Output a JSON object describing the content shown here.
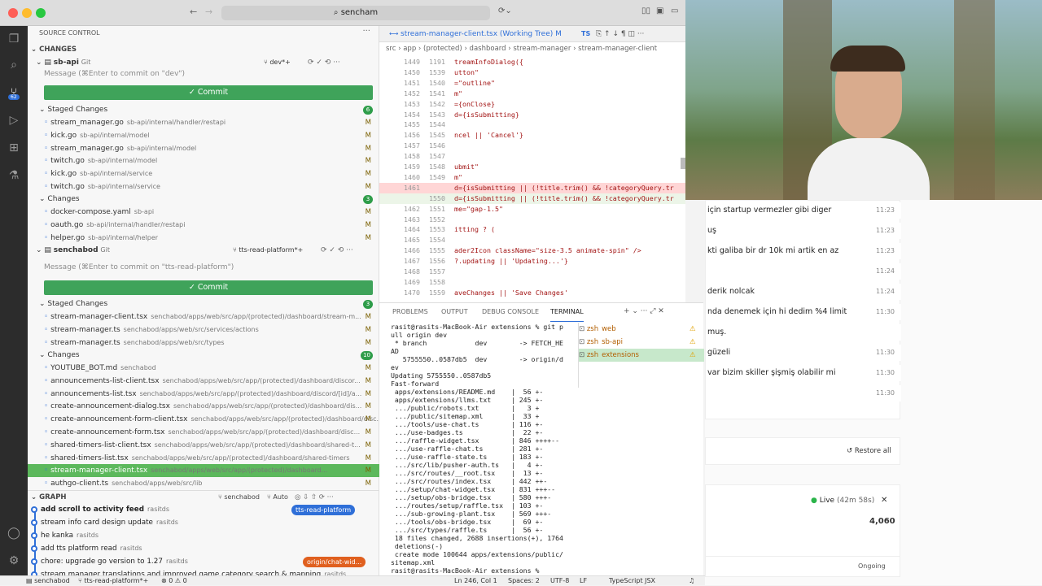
{
  "window": {
    "search": "sencham"
  },
  "sidebar": {
    "title": "SOURCE CONTROL",
    "changes_header": "CHANGES",
    "repo1": {
      "name": "sb-api",
      "vcs": "Git",
      "branch": "dev*+",
      "msg": "Message (⌘Enter to commit on \"dev\")",
      "commit": "Commit",
      "staged_label": "Staged Changes",
      "staged_count": "6",
      "staged": [
        {
          "file": "stream_manager.go",
          "path": "sb-api/internal/handler/restapi",
          "s": "M"
        },
        {
          "file": "kick.go",
          "path": "sb-api/internal/model",
          "s": "M"
        },
        {
          "file": "stream_manager.go",
          "path": "sb-api/internal/model",
          "s": "M"
        },
        {
          "file": "twitch.go",
          "path": "sb-api/internal/model",
          "s": "M"
        },
        {
          "file": "kick.go",
          "path": "sb-api/internal/service",
          "s": "M"
        },
        {
          "file": "twitch.go",
          "path": "sb-api/internal/service",
          "s": "M"
        }
      ],
      "changes_label": "Changes",
      "changes_count": "3",
      "changes": [
        {
          "file": "docker-compose.yaml",
          "path": "sb-api",
          "s": "M"
        },
        {
          "file": "oauth.go",
          "path": "sb-api/internal/handler/restapi",
          "s": "M"
        },
        {
          "file": "helper.go",
          "path": "sb-api/internal/helper",
          "s": "M"
        }
      ]
    },
    "repo2": {
      "name": "senchabod",
      "vcs": "Git",
      "branch": "tts-read-platform*+",
      "msg": "Message (⌘Enter to commit on \"tts-read-platform\")",
      "commit": "Commit",
      "staged_label": "Staged Changes",
      "staged_count": "3",
      "staged": [
        {
          "file": "stream-manager-client.tsx",
          "path": "senchabod/apps/web/src/app/(protected)/dashboard/stream-m...",
          "s": "M"
        },
        {
          "file": "stream-manager.ts",
          "path": "senchabod/apps/web/src/services/actions",
          "s": "M"
        },
        {
          "file": "stream-manager.ts",
          "path": "senchabod/apps/web/src/types",
          "s": "M"
        }
      ],
      "changes_label": "Changes",
      "changes_count": "10",
      "changes": [
        {
          "file": "YOUTUBE_BOT.md",
          "path": "senchabod",
          "s": "M"
        },
        {
          "file": "announcements-list-client.tsx",
          "path": "senchabod/apps/web/src/app/(protected)/dashboard/discor...",
          "s": "M"
        },
        {
          "file": "announcements-list.tsx",
          "path": "senchabod/apps/web/src/app/(protected)/dashboard/discord/[id]/a...",
          "s": "M"
        },
        {
          "file": "create-announcement-dialog.tsx",
          "path": "senchabod/apps/web/src/app/(protected)/dashboard/dis...",
          "s": "M"
        },
        {
          "file": "create-announcement-form-client.tsx",
          "path": "senchabod/apps/web/src/app/(protected)/dashboard/disc...",
          "s": "M"
        },
        {
          "file": "create-announcement-form.tsx",
          "path": "senchabod/apps/web/src/app/(protected)/dashboard/disc...",
          "s": "M"
        },
        {
          "file": "shared-timers-list-client.tsx",
          "path": "senchabod/apps/web/src/app/(protected)/dashboard/shared-t...",
          "s": "M"
        },
        {
          "file": "shared-timers-list.tsx",
          "path": "senchabod/apps/web/src/app/(protected)/dashboard/shared-timers",
          "s": "M"
        },
        {
          "file": "stream-manager-client.tsx",
          "path": "senchabod/apps/web/src/app/(protected)/dashboard...",
          "s": "M"
        },
        {
          "file": "authgo-client.ts",
          "path": "senchabod/apps/web/src/lib",
          "s": "M"
        }
      ]
    },
    "graph": {
      "label": "GRAPH",
      "branch": "senchabod",
      "auto": "Auto",
      "commits": [
        {
          "msg": "add scroll to activity feed",
          "author": "rasitds",
          "tag": "tts-read-platform"
        },
        {
          "msg": "stream info card design update",
          "author": "rasitds"
        },
        {
          "msg": "he kanka",
          "author": "rasitds"
        },
        {
          "msg": "add tts platform read",
          "author": "rasitds"
        },
        {
          "msg": "chore: upgrade go version to 1.27",
          "author": "rasitds",
          "tag": "origin/chat-wid..."
        },
        {
          "msg": "stream manager translations and improved game category search & mapping",
          "author": "rasitds"
        }
      ]
    }
  },
  "editor": {
    "tab": "stream-manager-client.tsx (Working Tree)",
    "tab_flag": "M",
    "tab2": "TS",
    "crumbs": "src › app › (protected) › dashboard › stream-manager › stream-manager-client",
    "lines": [
      {
        "a": "1449",
        "b": "1191",
        "c": "treamInfoDialog({",
        "k": ""
      },
      {
        "a": "1450",
        "b": "1539",
        "c": "utton\"",
        "k": ""
      },
      {
        "a": "1451",
        "b": "1540",
        "c": "=\"outline\"",
        "k": ""
      },
      {
        "a": "1452",
        "b": "1541",
        "c": "m\"",
        "k": ""
      },
      {
        "a": "1453",
        "b": "1542",
        "c": "={onClose}",
        "k": ""
      },
      {
        "a": "1454",
        "b": "1543",
        "c": "d={isSubmitting}",
        "k": ""
      },
      {
        "a": "1455",
        "b": "1544",
        "c": "",
        "k": ""
      },
      {
        "a": "1456",
        "b": "1545",
        "c": "ncel || 'Cancel'}",
        "k": ""
      },
      {
        "a": "1457",
        "b": "1546",
        "c": "",
        "k": ""
      },
      {
        "a": "1458",
        "b": "1547",
        "c": "",
        "k": ""
      },
      {
        "a": "1459",
        "b": "1548",
        "c": "ubmit\"",
        "k": ""
      },
      {
        "a": "1460",
        "b": "1549",
        "c": "m\"",
        "k": ""
      },
      {
        "a": "1461",
        "b": "",
        "c": "d={isSubmitting || (!title.trim() && !categoryQuery.tr",
        "k": "del"
      },
      {
        "a": "",
        "b": "1550",
        "c": "d={isSubmitting || (!title.trim() && !categoryQuery.tr",
        "k": "add"
      },
      {
        "a": "1462",
        "b": "1551",
        "c": "me=\"gap-1.5\"",
        "k": ""
      },
      {
        "a": "1463",
        "b": "1552",
        "c": "",
        "k": ""
      },
      {
        "a": "1464",
        "b": "1553",
        "c": "itting ? (",
        "k": ""
      },
      {
        "a": "1465",
        "b": "1554",
        "c": "",
        "k": ""
      },
      {
        "a": "1466",
        "b": "1555",
        "c": "ader2Icon className=\"size-3.5 animate-spin\" />",
        "k": ""
      },
      {
        "a": "1467",
        "b": "1556",
        "c": "?.updating || 'Updating...'}",
        "k": ""
      },
      {
        "a": "1468",
        "b": "1557",
        "c": "",
        "k": ""
      },
      {
        "a": "1469",
        "b": "1558",
        "c": "",
        "k": ""
      },
      {
        "a": "1470",
        "b": "1559",
        "c": "aveChanges || 'Save Changes'",
        "k": ""
      }
    ]
  },
  "panel": {
    "tabs": [
      "PROBLEMS",
      "OUTPUT",
      "DEBUG CONSOLE",
      "TERMINAL"
    ],
    "active": "TERMINAL",
    "terminal": "rasit@rasits-MacBook-Air extensions % git p\null origin dev\n * branch            dev        -> FETCH_HE\nAD\n   5755550..0587db5  dev        -> origin/d\nev\nUpdating 5755550..0587db5\nFast-forward\n apps/extensions/README.md    |  56 +-\n apps/extensions/llms.txt     | 245 +-\n .../public/robots.txt        |   3 +\n .../public/sitemap.xml       |  33 +\n .../tools/use-chat.ts        | 116 +-\n .../use-badges.ts            |  22 +-\n .../raffle-widget.tsx        | 846 ++++--\n .../use-raffle-chat.ts       | 281 +-\n .../use-raffle-state.ts      | 183 +-\n .../src/lib/pusher-auth.ts   |   4 +-\n .../src/routes/__root.tsx    |  13 +-\n .../src/routes/index.tsx     | 442 ++-\n .../setup/chat-widget.tsx    | 831 +++--\n .../setup/obs-bridge.tsx     | 580 +++-\n .../routes/setup/raffle.tsx  | 103 +-\n .../sub-growing-plant.tsx    | 569 +++-\n .../tools/obs-bridge.tsx     |  69 +-\n .../src/types/raffle.ts      |  56 +-\n 18 files changed, 2688 insertions(+), 1764\n deletions(-)\n create mode 100644 apps/extensions/public/\nsitemap.xml\nrasit@rasits-MacBook-Air extensions % ",
    "shells": [
      {
        "name": "zsh",
        "dir": "web"
      },
      {
        "name": "zsh",
        "dir": "sb-api"
      },
      {
        "name": "zsh",
        "dir": "extensions"
      }
    ]
  },
  "statusbar": {
    "left1": "senchabod",
    "left2": "tts-read-platform*+",
    "left3": "⊗ 0 ⚠ 0",
    "pos": "Ln 246, Col 1",
    "spaces": "Spaces: 2",
    "enc": "UTF-8",
    "eol": "LF",
    "lang": "TypeScript JSX"
  },
  "webapp": {
    "chats": [
      {
        "t": "için startup vermezler gibi diger",
        "time": "11:23"
      },
      {
        "t": "uş",
        "time": "11:23"
      },
      {
        "t": "kti galiba bir dr 10k mi artik en az",
        "time": "11:23"
      },
      {
        "t": "",
        "time": "11:24"
      },
      {
        "t": "derik nolcak",
        "time": "11:24"
      },
      {
        "t": "nda denemek için hi dedim %4 limit",
        "time": "11:30"
      },
      {
        "t": "muş.",
        "time": ""
      },
      {
        "t": "güzeli",
        "time": "11:30"
      },
      {
        "t": "var bizim skiller şişmiş olabilir mi",
        "time": "11:30"
      },
      {
        "t": "",
        "time": "11:30"
      }
    ],
    "restore": "Restore all",
    "live": "Live",
    "duration": "(42m 58s)",
    "count": "4,060",
    "ongoing": "Ongoing"
  }
}
